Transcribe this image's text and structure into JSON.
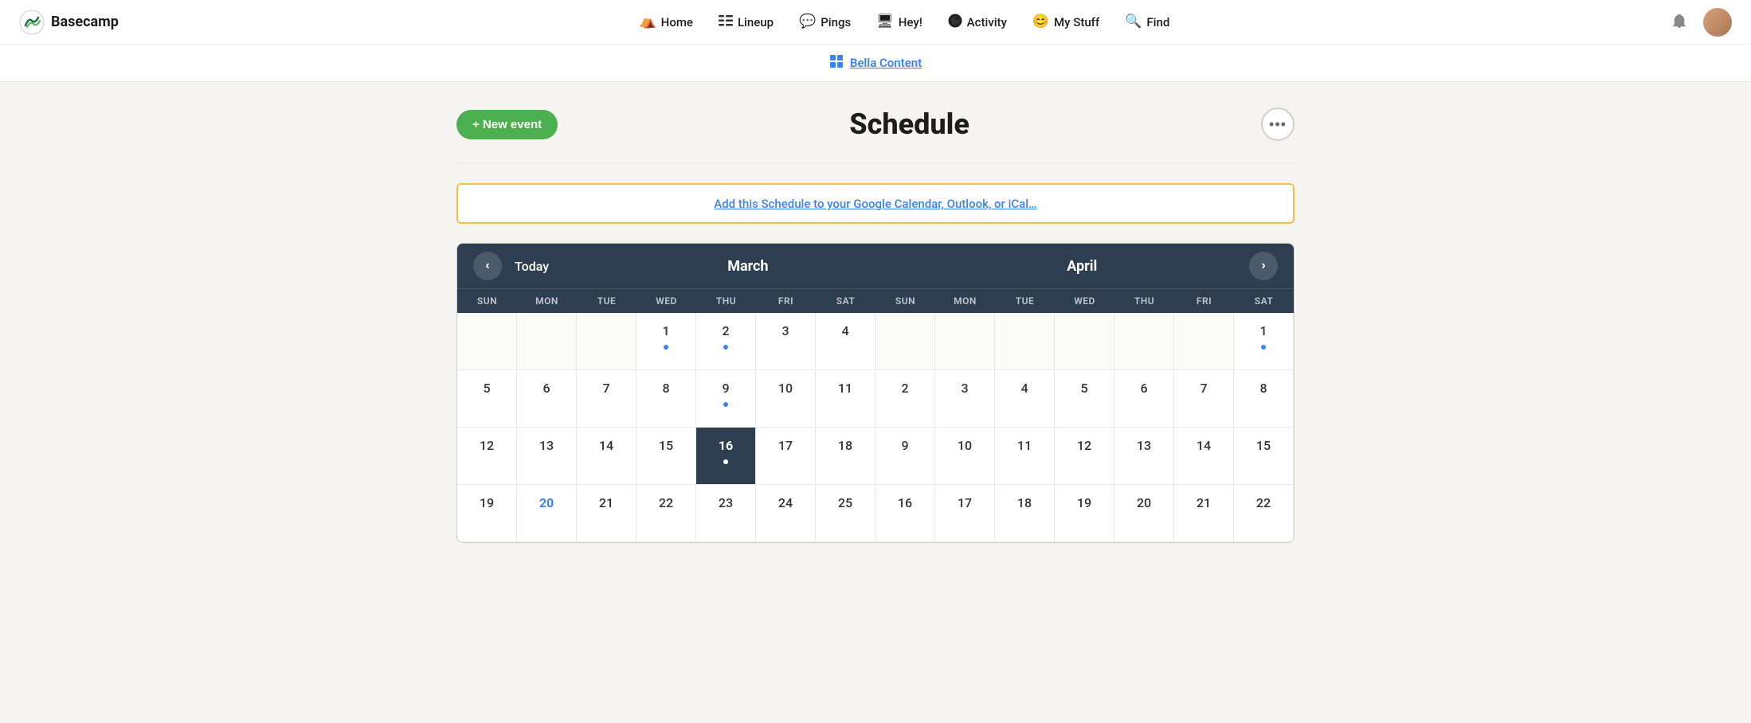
{
  "app": {
    "name": "Basecamp"
  },
  "nav": {
    "logo_text": "Basecamp",
    "links": [
      {
        "id": "home",
        "label": "Home",
        "icon": "⛺"
      },
      {
        "id": "lineup",
        "label": "Lineup",
        "icon": "☰"
      },
      {
        "id": "pings",
        "label": "Pings",
        "icon": "💬"
      },
      {
        "id": "hey",
        "label": "Hey!",
        "icon": "🖥"
      },
      {
        "id": "activity",
        "label": "Activity",
        "icon": "🌑"
      },
      {
        "id": "mystuff",
        "label": "My Stuff",
        "icon": "😊"
      },
      {
        "id": "find",
        "label": "Find",
        "icon": "🔍"
      }
    ]
  },
  "breadcrumb": {
    "icon": "⊞",
    "label": "Bella Content",
    "link_text": "Bella Content"
  },
  "page": {
    "title": "Schedule",
    "new_event_label": "+ New event",
    "more_label": "•••",
    "sync_link_text": "Add this Schedule to your Google Calendar, Outlook, or iCal…"
  },
  "calendar": {
    "today_label": "Today",
    "prev_icon": "‹",
    "next_icon": "›",
    "months": [
      {
        "name": "March"
      },
      {
        "name": "April"
      }
    ],
    "day_labels": [
      "SUN",
      "MON",
      "TUE",
      "WED",
      "THU",
      "FRI",
      "SAT",
      "SUN",
      "MON",
      "TUE",
      "WED",
      "THU",
      "FRI",
      "SAT"
    ],
    "rows": [
      [
        {
          "date": "",
          "empty": true
        },
        {
          "date": "",
          "empty": true
        },
        {
          "date": "",
          "empty": true
        },
        {
          "date": "1",
          "dot": true
        },
        {
          "date": "2",
          "dot": true
        },
        {
          "date": "3"
        },
        {
          "date": "4"
        },
        {
          "date": "",
          "empty": true
        },
        {
          "date": "",
          "empty": true
        },
        {
          "date": "",
          "empty": true
        },
        {
          "date": "",
          "empty": true
        },
        {
          "date": "",
          "empty": true
        },
        {
          "date": "",
          "empty": true
        },
        {
          "date": "1",
          "dot": true
        }
      ],
      [
        {
          "date": "5"
        },
        {
          "date": "6"
        },
        {
          "date": "7"
        },
        {
          "date": "8"
        },
        {
          "date": "9",
          "dot": true
        },
        {
          "date": "10"
        },
        {
          "date": "11"
        },
        {
          "date": "2"
        },
        {
          "date": "3"
        },
        {
          "date": "4"
        },
        {
          "date": "5"
        },
        {
          "date": "6"
        },
        {
          "date": "7"
        },
        {
          "date": "8"
        }
      ],
      [
        {
          "date": "12"
        },
        {
          "date": "13"
        },
        {
          "date": "14"
        },
        {
          "date": "15"
        },
        {
          "date": "16",
          "today": true,
          "dot": true
        },
        {
          "date": "17"
        },
        {
          "date": "18"
        },
        {
          "date": "9"
        },
        {
          "date": "10"
        },
        {
          "date": "11"
        },
        {
          "date": "12"
        },
        {
          "date": "13"
        },
        {
          "date": "14"
        },
        {
          "date": "15"
        }
      ],
      [
        {
          "date": "19"
        },
        {
          "date": "20",
          "highlight": true
        },
        {
          "date": "21"
        },
        {
          "date": "22"
        },
        {
          "date": "23"
        },
        {
          "date": "24"
        },
        {
          "date": "25"
        },
        {
          "date": "16"
        },
        {
          "date": "17"
        },
        {
          "date": "18"
        },
        {
          "date": "19"
        },
        {
          "date": "20"
        },
        {
          "date": "21"
        },
        {
          "date": "22"
        }
      ]
    ]
  }
}
